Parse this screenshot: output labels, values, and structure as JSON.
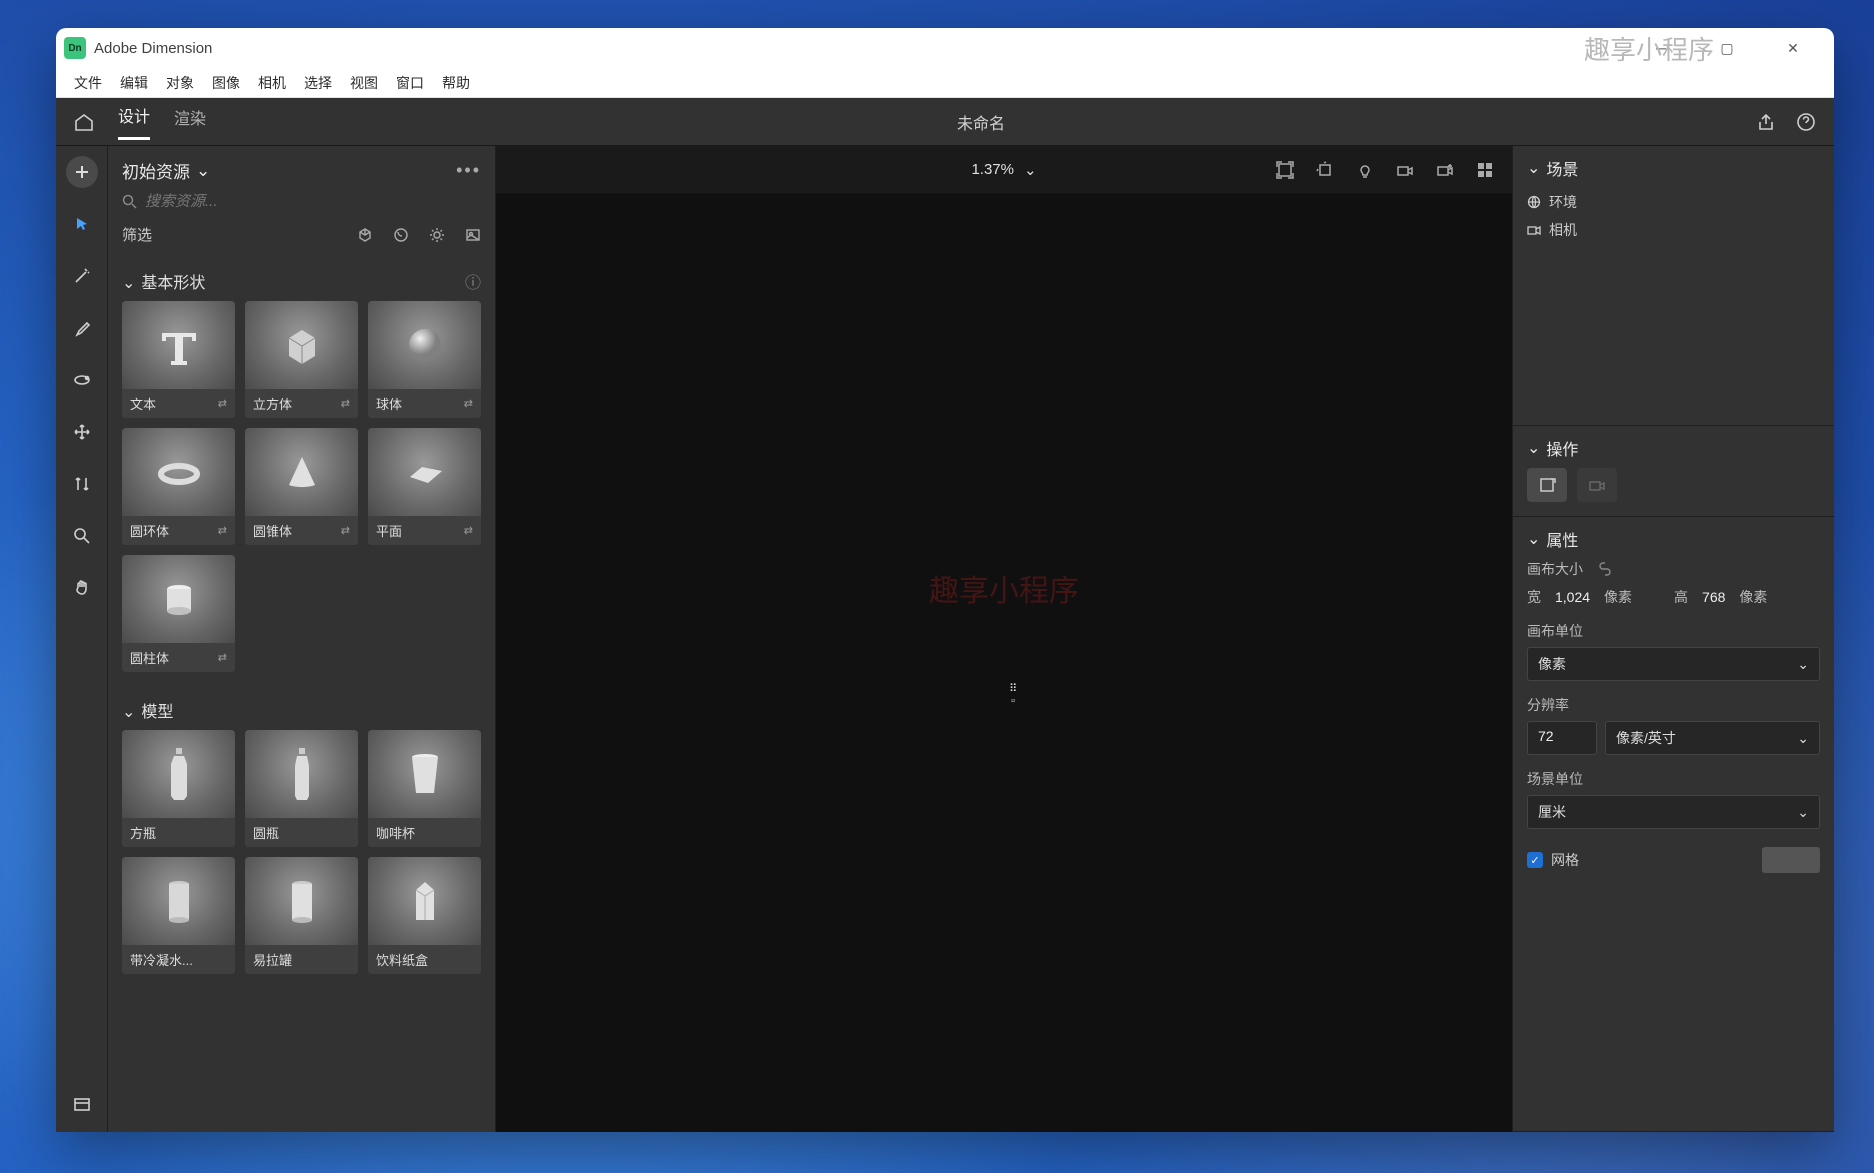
{
  "app": {
    "title": "Adobe Dimension",
    "watermark": "趣享小程序"
  },
  "menubar": [
    "文件",
    "编辑",
    "对象",
    "图像",
    "相机",
    "选择",
    "视图",
    "窗口",
    "帮助"
  ],
  "tabs": {
    "design": "设计",
    "render": "渲染",
    "docTitle": "未命名"
  },
  "assets": {
    "title": "初始资源",
    "searchPlaceholder": "搜索资源...",
    "filterLabel": "筛选",
    "sections": {
      "basic": {
        "title": "基本形状",
        "items": [
          "文本",
          "立方体",
          "球体",
          "圆环体",
          "圆锥体",
          "平面",
          "圆柱体"
        ]
      },
      "models": {
        "title": "模型",
        "items": [
          "方瓶",
          "圆瓶",
          "咖啡杯",
          "带冷凝水...",
          "易拉罐",
          "饮料纸盒"
        ]
      }
    }
  },
  "canvas": {
    "zoom": "1.37%",
    "watermark": "趣享小程序"
  },
  "scene": {
    "title": "场景",
    "items": [
      {
        "icon": "globe",
        "label": "环境"
      },
      {
        "icon": "camera",
        "label": "相机"
      }
    ]
  },
  "ops": {
    "title": "操作"
  },
  "props": {
    "title": "属性",
    "canvasSizeLabel": "画布大小",
    "widthLabel": "宽",
    "widthValue": "1,024",
    "widthUnit": "像素",
    "heightLabel": "高",
    "heightValue": "768",
    "heightUnit": "像素",
    "canvasUnitLabel": "画布单位",
    "canvasUnit": "像素",
    "resolutionLabel": "分辨率",
    "resolutionValue": "72",
    "resolutionUnit": "像素/英寸",
    "sceneUnitLabel": "场景单位",
    "sceneUnit": "厘米",
    "gridLabel": "网格"
  }
}
